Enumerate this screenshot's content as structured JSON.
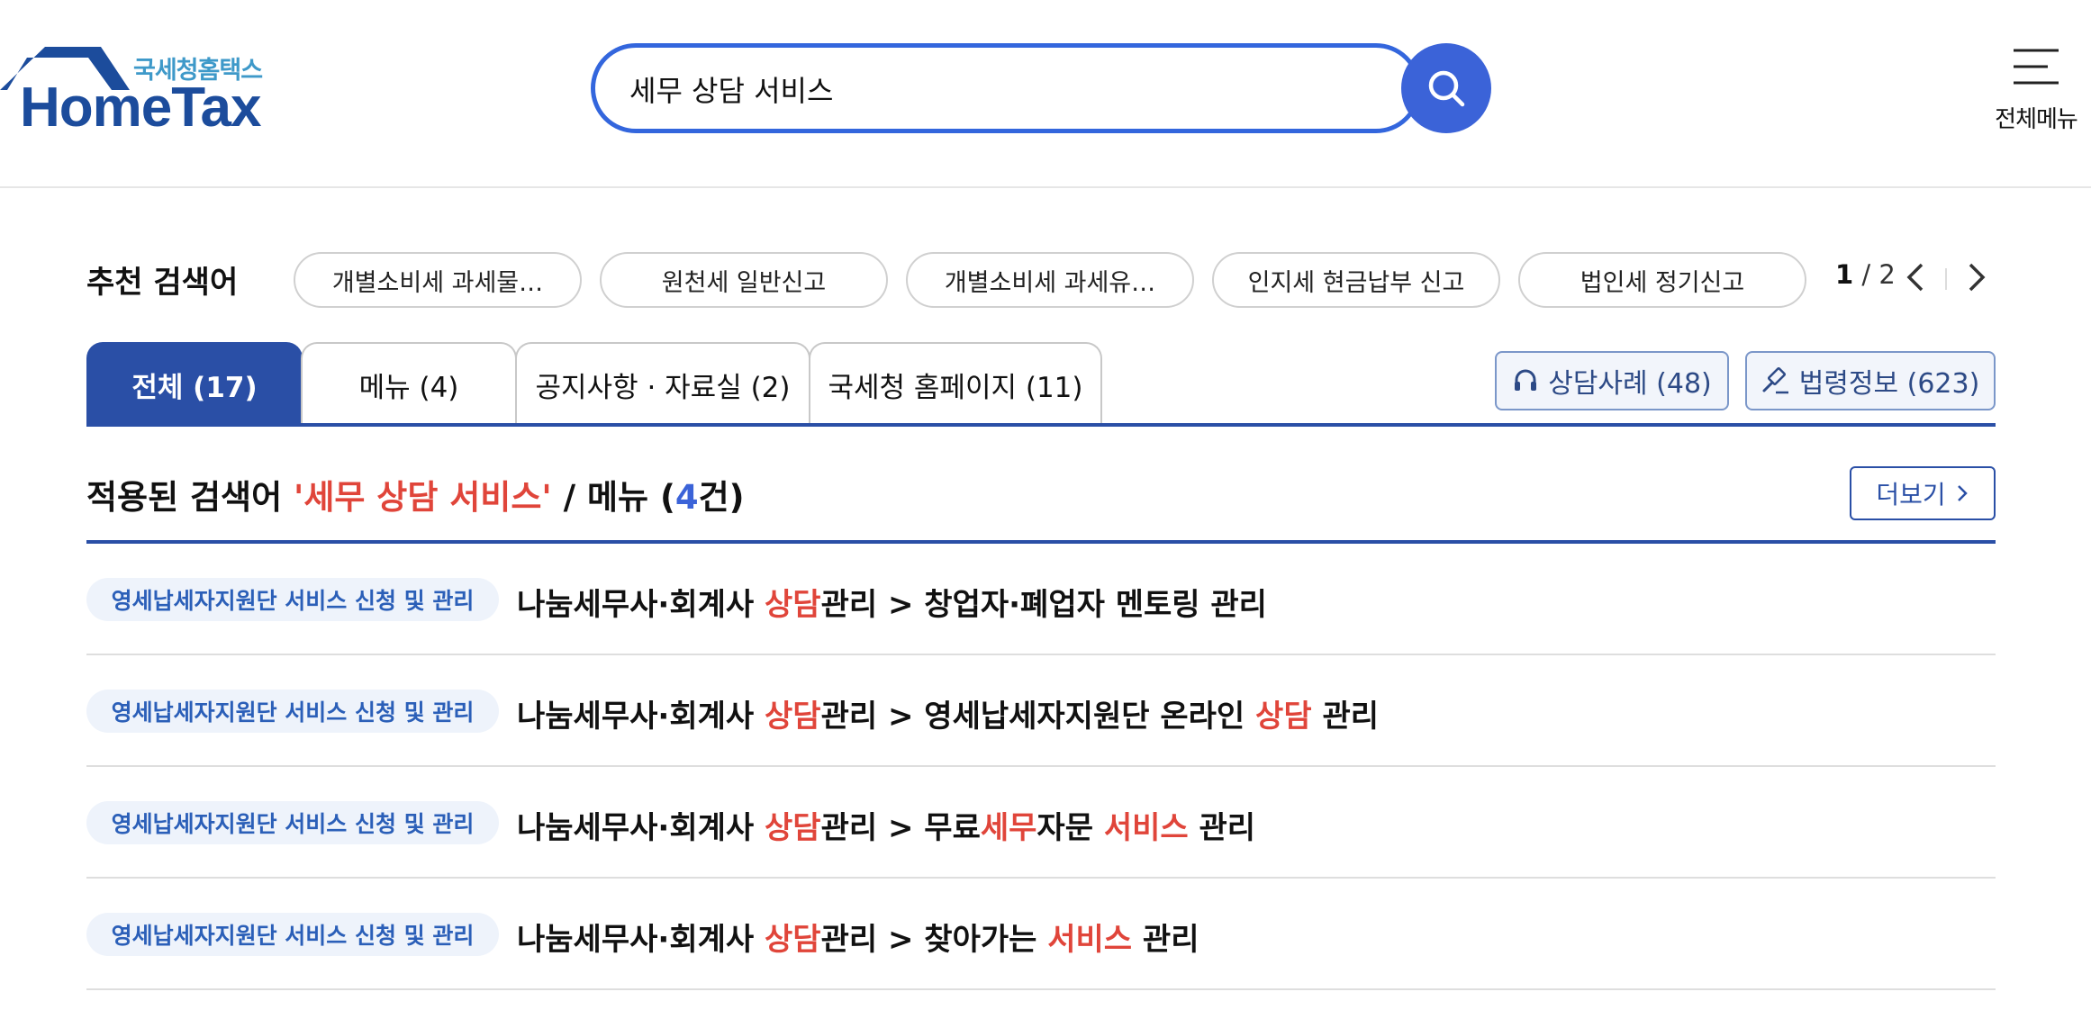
{
  "header": {
    "logo_sub": "국세청홈택스",
    "logo_main": "HomeTax",
    "search_value": "세무 상담 서비스",
    "all_menu_label": "전체메뉴"
  },
  "recommended": {
    "title": "추천 검색어",
    "chips": [
      "개별소비세 과세물…",
      "원천세 일반신고",
      "개별소비세 과세유…",
      "인지세 현금납부 신고",
      "법인세 정기신고"
    ],
    "page_current": "1",
    "page_sep": " / ",
    "page_total": "2"
  },
  "tabs": [
    {
      "label": "전체 (17)",
      "active": true
    },
    {
      "label": "메뉴 (4)",
      "active": false
    },
    {
      "label": "공지사항 · 자료실 (2)",
      "active": false
    },
    {
      "label": "국세청 홈페이지 (11)",
      "active": false
    }
  ],
  "side_buttons": {
    "consult_cases": "상담사례 (48)",
    "law_info": "법령정보 (623)"
  },
  "results": {
    "title_prefix": "적용된 검색어 ",
    "title_keyword": "'세무 상담 서비스'",
    "title_mid": " / 메뉴 (",
    "title_count": "4",
    "title_suffix": "건)",
    "more_label": "더보기",
    "items": [
      {
        "tag": "영세납세자지원단 서비스 신청 및 관리",
        "parts": [
          {
            "t": "나눔세무사·회계사 ",
            "h": false
          },
          {
            "t": "상담",
            "h": true
          },
          {
            "t": "관리 > 창업자·폐업자 멘토링 관리",
            "h": false
          }
        ]
      },
      {
        "tag": "영세납세자지원단 서비스 신청 및 관리",
        "parts": [
          {
            "t": "나눔세무사·회계사 ",
            "h": false
          },
          {
            "t": "상담",
            "h": true
          },
          {
            "t": "관리 > 영세납세자지원단 온라인 ",
            "h": false
          },
          {
            "t": "상담",
            "h": true
          },
          {
            "t": " 관리",
            "h": false
          }
        ]
      },
      {
        "tag": "영세납세자지원단 서비스 신청 및 관리",
        "parts": [
          {
            "t": "나눔세무사·회계사 ",
            "h": false
          },
          {
            "t": "상담",
            "h": true
          },
          {
            "t": "관리 > 무료",
            "h": false
          },
          {
            "t": "세무",
            "h": true
          },
          {
            "t": "자문 ",
            "h": false
          },
          {
            "t": "서비스",
            "h": true
          },
          {
            "t": " 관리",
            "h": false
          }
        ]
      },
      {
        "tag": "영세납세자지원단 서비스 신청 및 관리",
        "parts": [
          {
            "t": "나눔세무사·회계사 ",
            "h": false
          },
          {
            "t": "상담",
            "h": true
          },
          {
            "t": "관리 > 찾아가는 ",
            "h": false
          },
          {
            "t": "서비스",
            "h": true
          },
          {
            "t": " 관리",
            "h": false
          }
        ]
      }
    ]
  },
  "colors": {
    "brand_blue": "#2a4fa6",
    "search_blue": "#3b63d8",
    "highlight_red": "#e0453a"
  }
}
